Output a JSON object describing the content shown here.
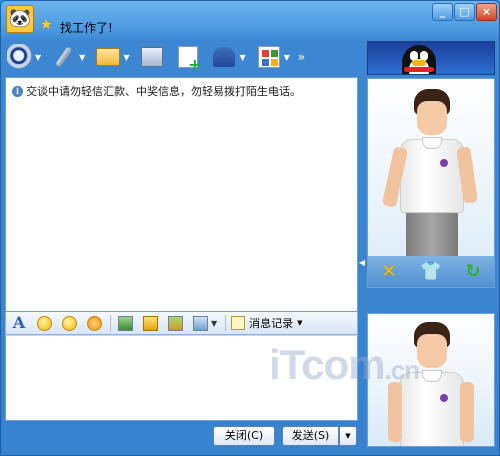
{
  "titlebar": {
    "contact_name": "找工作了!",
    "buttons": [
      "_",
      "□",
      "×"
    ]
  },
  "toolbar": {
    "more_label": "»"
  },
  "chat": {
    "notice": "交谈中请勿轻信汇款、中奖信息，勿轻易拨打陌生电话。"
  },
  "format_bar": {
    "font_label": "A",
    "history_label": "消息记录"
  },
  "buttons": {
    "close_label": "关闭(C)",
    "send_label": "发送(S)",
    "send_arrow": "▼"
  },
  "watermark": {
    "text_main": "iT",
    "text_mid": "com",
    "text_sub": ".cn"
  },
  "colors": {
    "window": "#3883cf",
    "accent": "#2d6fd0",
    "panel_border": "#6f9fd4"
  },
  "icons": [
    "webcam-icon",
    "microphone-icon",
    "folder-icon",
    "video-icon",
    "add-note-icon",
    "contact-card-icon",
    "apps-icon",
    "font-icon",
    "smiley-icon",
    "wink-icon",
    "flower-icon",
    "screenshot-icon",
    "music-icon",
    "image-icon",
    "history-icon",
    "change-icon",
    "shirt-icon",
    "refresh-icon"
  ]
}
